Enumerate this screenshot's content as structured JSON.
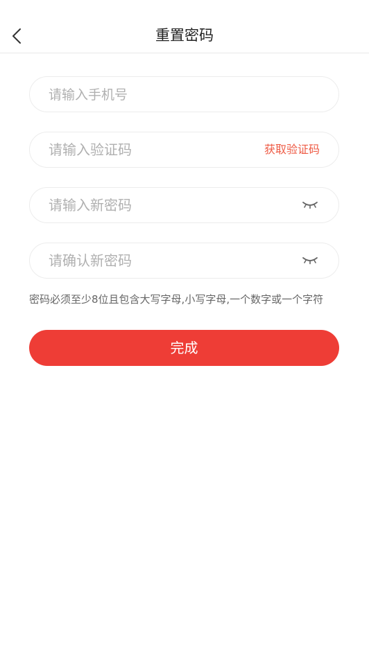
{
  "nav": {
    "title": "重置密码",
    "back_icon": "chevron-left-icon"
  },
  "form": {
    "phone": {
      "value": "",
      "placeholder": "请输入手机号"
    },
    "code": {
      "value": "",
      "placeholder": "请输入验证码",
      "send_label": "获取验证码"
    },
    "new_password": {
      "value": "",
      "placeholder": "请输入新密码",
      "toggle_icon": "eye-closed-icon"
    },
    "confirm_password": {
      "value": "",
      "placeholder": "请确认新密码",
      "toggle_icon": "eye-closed-icon"
    },
    "hint": "密码必须至少8位且包含大写字母,小写字母,一个数字或一个字符",
    "submit_label": "完成"
  },
  "colors": {
    "accent": "#ee3d36",
    "code_link": "#ee5a44",
    "placeholder": "#b0b0b0",
    "hint": "#666666"
  }
}
